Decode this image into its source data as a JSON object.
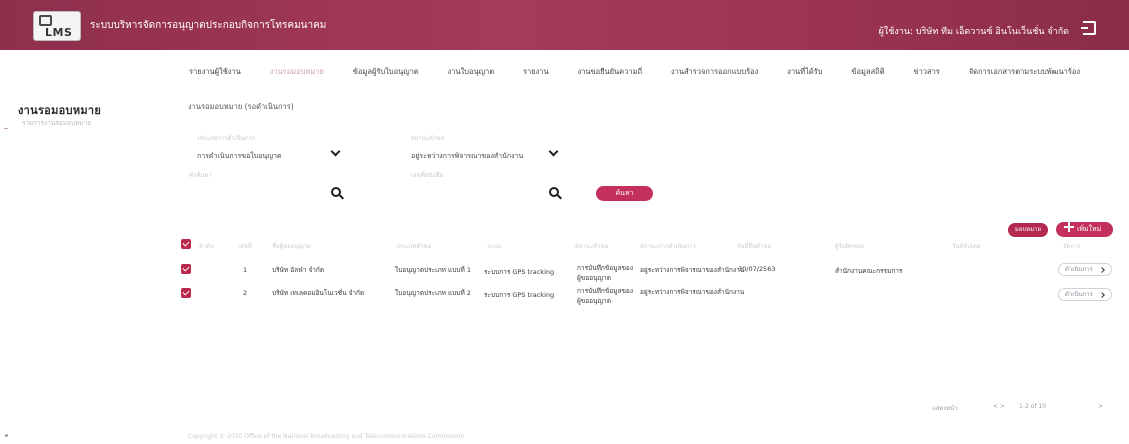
{
  "header": {
    "logo_text": "LMS",
    "title": "ระบบบริหารจัดการอนุญาตประกอบกิจการโทรคมนาคม",
    "user_name": "ผู้ใช้งาน: บริษัท ทีม เอ็ดวานซ์ อินโนเว็นชั่น จำกัด"
  },
  "nav": {
    "items": [
      "รายงานผู้ใช้งาน",
      "งานรอมอบหมาย",
      "ข้อมูลผู้รับใบอนุญาต",
      "งานใบอนุญาต",
      "รายงาน",
      "งานขอยืนยันความถี่",
      "งานสำรวจการออกแบบร้อง",
      "งานที่ได้รับ",
      "ข้อมูลสถิติ",
      "ข่าวสาร",
      "จัดการเอกสารตามระบบพัฒนาร้อง"
    ],
    "active_index": 1
  },
  "sidebar": {
    "title": "งานรอมอบหมาย",
    "subtitle": "รายการงานรอมอบหมาย"
  },
  "breadcrumb": "งานรอมอบหมาย (รอดำเนินการ)",
  "filters": {
    "type_label": "ประเภทการดำเนินการ",
    "type_value": "การดำเนินการขอใบอนุญาต",
    "status_label": "สถานะคำขอ",
    "status_value": "อยู่ระหว่างการพิจารณาของสำนักงาน",
    "keyword_label": "คำค้นหา",
    "doc_label": "เลขที่หนังสือ",
    "search_button": "ค้นหา"
  },
  "actions": {
    "manage_button": "มอบหมาย",
    "add_button": "เพิ่มใหม่"
  },
  "table": {
    "headers": [
      "ลำดับ",
      "เลขที่",
      "ชื่อผู้ขออนุญาต",
      "ประเภทคำขอ",
      "ระบบ",
      "สถานะคำขอ",
      "สถานะการดำเนินการ",
      "วันที่ยื่นคำขอ",
      "ผู้รับผิดชอบ",
      "วันที่อัปเดต",
      "จัดการ"
    ],
    "rows": [
      {
        "no": "1",
        "company": "บริษัท อัลฟ่า จำกัด",
        "license": "ใบอนุญาตประเภท แบบที่ 1",
        "system": "ระบบการ GPS tracking",
        "status_lines": [
          "การบันทึกข้อมูลของ",
          "ผู้ขออนุญาต"
        ],
        "process": "อยู่ระหว่างการพิจารณาของสำนักงาน",
        "date": "30/07/2563",
        "assignee": "สำนักงานคณะกรรมการ",
        "action": "ดำเนินการ"
      },
      {
        "no": "2",
        "company": "บริษัท เทเลคอมอินโนเวชั่น จำกัด",
        "license": "ใบอนุญาตประเภท แบบที่ 2",
        "system": "ระบบการ GPS tracking",
        "status_lines": [
          "การบันทึกข้อมูลของ",
          "ผู้ขออนุญาต"
        ],
        "process": "อยู่ระหว่างการพิจารณาของสำนักงาน",
        "date": "",
        "assignee": "",
        "action": "ดำเนินการ"
      }
    ]
  },
  "pagination": {
    "per_page": "แสดงหน้า",
    "nav": "<   >",
    "range": "1-2 of 10",
    "end": ">"
  },
  "footer": "Copyright © 2020 Office of the National Broadcasting and Telecommunications Commission"
}
